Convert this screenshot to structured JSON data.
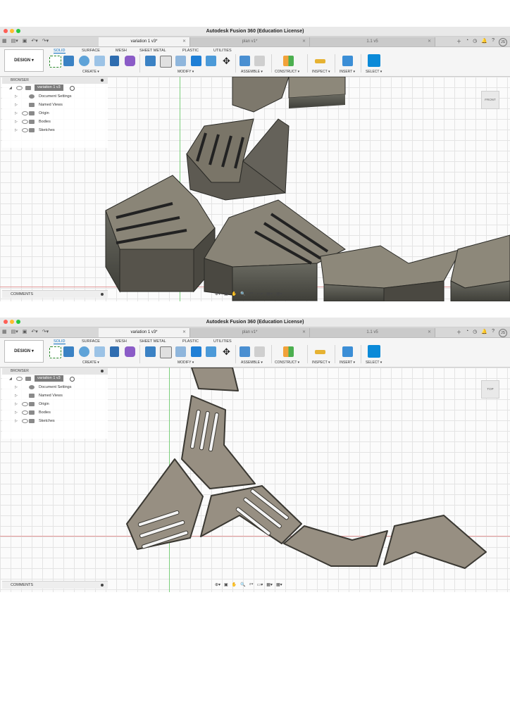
{
  "app": {
    "title": "Autodesk Fusion 360 (Education License)",
    "tabs": [
      {
        "label": "variation 1 v3*",
        "active": true
      },
      {
        "label": "plan v1*",
        "active": false
      },
      {
        "label": "1.1 v5",
        "active": false
      }
    ],
    "user_initials": "JS"
  },
  "toolbar": {
    "workspace": "DESIGN",
    "tabs": [
      "SOLID",
      "SURFACE",
      "MESH",
      "SHEET METAL",
      "PLASTIC",
      "UTILITIES"
    ],
    "groups": [
      "CREATE ▾",
      "MODIFY ▾",
      "ASSEMBLE ▾",
      "CONSTRUCT ▾",
      "INSPECT ▾",
      "INSERT ▾",
      "SELECT ▾"
    ]
  },
  "browser": {
    "title": "BROWSER",
    "root": "variation 1 v3",
    "items": [
      "Document Settings",
      "Named Views",
      "Origin",
      "Bodies",
      "Sketches"
    ]
  },
  "comments": "COMMENTS",
  "viewcube": {
    "shot1_faces": [
      "TOP",
      "FRONT"
    ],
    "shot2_face": "TOP"
  },
  "colors": {
    "body_top": "#8d887a",
    "body_side": "#5a5a52",
    "flat_fill": "#978f82",
    "accent": "#0b6fc1"
  }
}
